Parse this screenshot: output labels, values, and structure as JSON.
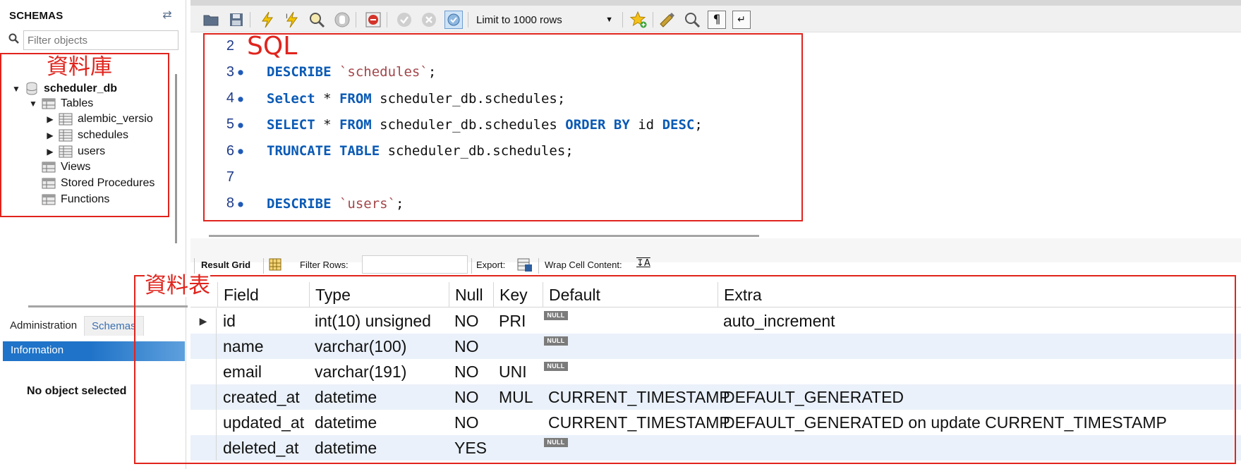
{
  "sidebar": {
    "title": "SCHEMAS",
    "filter_placeholder": "Filter objects",
    "database": "scheduler_db",
    "tables_label": "Tables",
    "tables": [
      "alembic_versio",
      "schedules",
      "users"
    ],
    "views_label": "Views",
    "procedures_label": "Stored Procedures",
    "functions_label": "Functions",
    "tabs": [
      "Administration",
      "Schemas"
    ],
    "active_tab": "Schemas",
    "info_header": "Information",
    "no_object": "No object selected"
  },
  "toolbar": {
    "limit_label": "Limit to 1000 rows",
    "icons": [
      "open-folder-icon",
      "save-icon",
      "execute-icon",
      "execute-current-icon",
      "explain-icon",
      "stop-icon",
      "toggle-error-icon",
      "commit-icon",
      "rollback-icon",
      "autocommit-icon",
      "limit-dropdown",
      "bookmark-add-icon",
      "beautify-icon",
      "find-icon",
      "invisible-chars-icon",
      "wrap-icon"
    ]
  },
  "editor": {
    "lines": [
      {
        "num": "2",
        "dot": false,
        "tokens": []
      },
      {
        "num": "3",
        "dot": true,
        "tokens": [
          {
            "t": "kw",
            "v": "DESCRIBE"
          },
          {
            "t": "plain",
            "v": " "
          },
          {
            "t": "str",
            "v": "`schedules`"
          },
          {
            "t": "plain",
            "v": ";"
          }
        ]
      },
      {
        "num": "4",
        "dot": true,
        "tokens": [
          {
            "t": "kw",
            "v": "Select"
          },
          {
            "t": "plain",
            "v": " * "
          },
          {
            "t": "kw",
            "v": "FROM"
          },
          {
            "t": "plain",
            "v": " scheduler_db.schedules;"
          }
        ]
      },
      {
        "num": "5",
        "dot": true,
        "tokens": [
          {
            "t": "kw",
            "v": "SELECT"
          },
          {
            "t": "plain",
            "v": " * "
          },
          {
            "t": "kw",
            "v": "FROM"
          },
          {
            "t": "plain",
            "v": " scheduler_db.schedules "
          },
          {
            "t": "kw",
            "v": "ORDER BY"
          },
          {
            "t": "plain",
            "v": " id "
          },
          {
            "t": "kw",
            "v": "DESC"
          },
          {
            "t": "plain",
            "v": ";"
          }
        ]
      },
      {
        "num": "6",
        "dot": true,
        "tokens": [
          {
            "t": "kw",
            "v": "TRUNCATE TABLE"
          },
          {
            "t": "plain",
            "v": " scheduler_db.schedules;"
          }
        ]
      },
      {
        "num": "7",
        "dot": false,
        "tokens": []
      },
      {
        "num": "8",
        "dot": true,
        "tokens": [
          {
            "t": "kw",
            "v": "DESCRIBE"
          },
          {
            "t": "plain",
            "v": " "
          },
          {
            "t": "str",
            "v": "`users`"
          },
          {
            "t": "plain",
            "v": ";"
          }
        ]
      }
    ]
  },
  "result_toolbar": {
    "result_grid": "Result Grid",
    "filter_rows": "Filter Rows:",
    "export": "Export:",
    "wrap_cell": "Wrap Cell Content:"
  },
  "grid": {
    "columns": [
      "Field",
      "Type",
      "Null",
      "Key",
      "Default",
      "Extra"
    ],
    "null_badge": "NULL",
    "rows": [
      {
        "field": "id",
        "type": "int(10) unsigned",
        "null": "NO",
        "key": "PRI",
        "default": null,
        "extra": "auto_increment"
      },
      {
        "field": "name",
        "type": "varchar(100)",
        "null": "NO",
        "key": "",
        "default": null,
        "extra": ""
      },
      {
        "field": "email",
        "type": "varchar(191)",
        "null": "NO",
        "key": "UNI",
        "default": null,
        "extra": ""
      },
      {
        "field": "created_at",
        "type": "datetime",
        "null": "NO",
        "key": "MUL",
        "default": "CURRENT_TIMESTAMP",
        "extra": "DEFAULT_GENERATED"
      },
      {
        "field": "updated_at",
        "type": "datetime",
        "null": "NO",
        "key": "",
        "default": "CURRENT_TIMESTAMP",
        "extra": "DEFAULT_GENERATED on update CURRENT_TIMESTAMP"
      },
      {
        "field": "deleted_at",
        "type": "datetime",
        "null": "YES",
        "key": "",
        "default": null,
        "extra": ""
      }
    ]
  },
  "annotations": {
    "database_label": "資料庫",
    "sql_label": "SQL",
    "table_label": "資料表",
    "color": "#e0241d"
  },
  "colors": {
    "keyword": "#0a5ab5",
    "string": "#a3464a",
    "info_header": "#2a78c6",
    "alt_row": "#eaf1fa"
  }
}
